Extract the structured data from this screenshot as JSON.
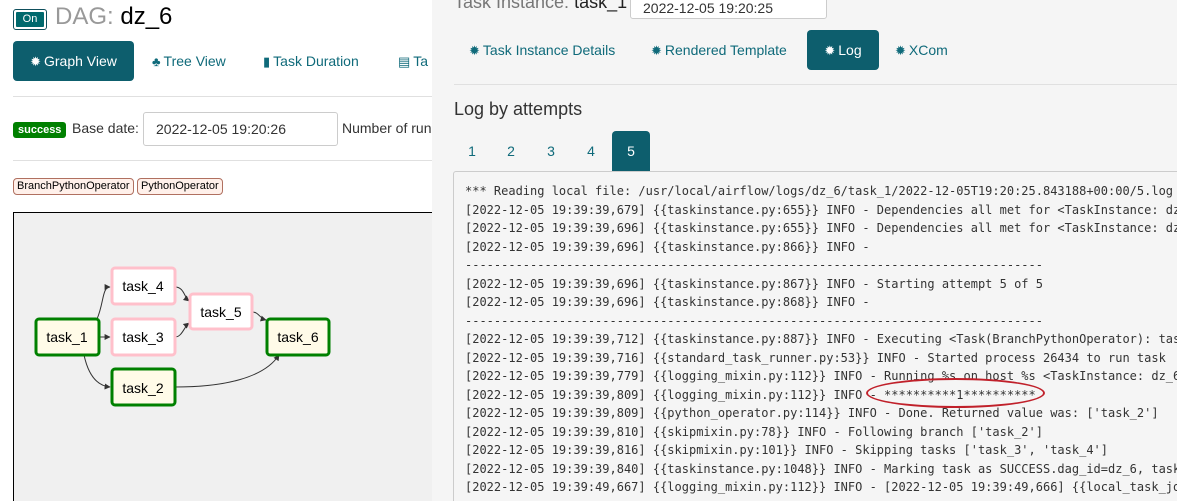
{
  "dag": {
    "toggle_label": "On",
    "title_prefix": "DAG:",
    "dag_id": "dz_6"
  },
  "views": [
    {
      "label": "Graph View",
      "icon": "asterisk-icon",
      "active": true
    },
    {
      "label": "Tree View",
      "icon": "tree-icon",
      "active": false
    },
    {
      "label": "Task Duration",
      "icon": "bar-chart-icon",
      "active": false
    },
    {
      "label": "Ta",
      "icon": "file-icon",
      "active": false
    }
  ],
  "graph_controls": {
    "state_badge": "success",
    "base_date_label": "Base date:",
    "base_date_value": "2022-12-05 19:20:26",
    "num_runs_label": "Number of run"
  },
  "operators": [
    "BranchPythonOperator",
    "PythonOperator"
  ],
  "graph": {
    "nodes": [
      {
        "id": "task_1",
        "state": "success"
      },
      {
        "id": "task_2",
        "state": "success"
      },
      {
        "id": "task_3",
        "state": "skipped"
      },
      {
        "id": "task_4",
        "state": "skipped"
      },
      {
        "id": "task_5",
        "state": "skipped"
      },
      {
        "id": "task_6",
        "state": "success"
      }
    ],
    "colors": {
      "success": "#008000",
      "skipped": "#ffc0cb",
      "background": "#f0f0f0"
    }
  },
  "task_instance": {
    "label": "Task Instance:",
    "task_id": "task_1",
    "execution_date": "2022-12-05 19:20:25"
  },
  "tabs": [
    {
      "label": "Task Instance Details",
      "icon": "asterisk-icon",
      "active": false
    },
    {
      "label": "Rendered Template",
      "icon": "asterisk-icon",
      "active": false
    },
    {
      "label": "Log",
      "icon": "asterisk-icon",
      "active": true
    },
    {
      "label": "XCom",
      "icon": "asterisk-icon",
      "active": false
    }
  ],
  "log": {
    "heading": "Log by attempts",
    "attempts": [
      "1",
      "2",
      "3",
      "4",
      "5"
    ],
    "active_attempt": "5",
    "lines": [
      "*** Reading local file: /usr/local/airflow/logs/dz_6/task_1/2022-12-05T19:20:25.843188+00:00/5.log",
      "[2022-12-05 19:39:39,679] {{taskinstance.py:655}} INFO - Dependencies all met for <TaskInstance: dz_",
      "[2022-12-05 19:39:39,696] {{taskinstance.py:655}} INFO - Dependencies all met for <TaskInstance: dz_",
      "[2022-12-05 19:39:39,696] {{taskinstance.py:866}} INFO -",
      "--------------------------------------------------------------------------------",
      "[2022-12-05 19:39:39,696] {{taskinstance.py:867}} INFO - Starting attempt 5 of 5",
      "[2022-12-05 19:39:39,696] {{taskinstance.py:868}} INFO -",
      "--------------------------------------------------------------------------------",
      "[2022-12-05 19:39:39,712] {{taskinstance.py:887}} INFO - Executing <Task(BranchPythonOperator): task",
      "[2022-12-05 19:39:39,716] {{standard_task_runner.py:53}} INFO - Started process 26434 to run task",
      "[2022-12-05 19:39:39,779] {{logging_mixin.py:112}} INFO - Running %s on host %s <TaskInstance: dz_6.",
      "[2022-12-05 19:39:39,809] {{logging_mixin.py:112}} INFO - **********1**********",
      "[2022-12-05 19:39:39,809] {{python_operator.py:114}} INFO - Done. Returned value was: ['task_2']",
      "[2022-12-05 19:39:39,810] {{skipmixin.py:78}} INFO - Following branch ['task_2']",
      "[2022-12-05 19:39:39,816] {{skipmixin.py:101}} INFO - Skipping tasks ['task_3', 'task_4']",
      "[2022-12-05 19:39:39,840] {{taskinstance.py:1048}} INFO - Marking task as SUCCESS.dag_id=dz_6, task_",
      "[2022-12-05 19:39:49,667] {{logging_mixin.py:112}} INFO - [2022-12-05 19:39:49,666] {{local_task_job"
    ]
  }
}
